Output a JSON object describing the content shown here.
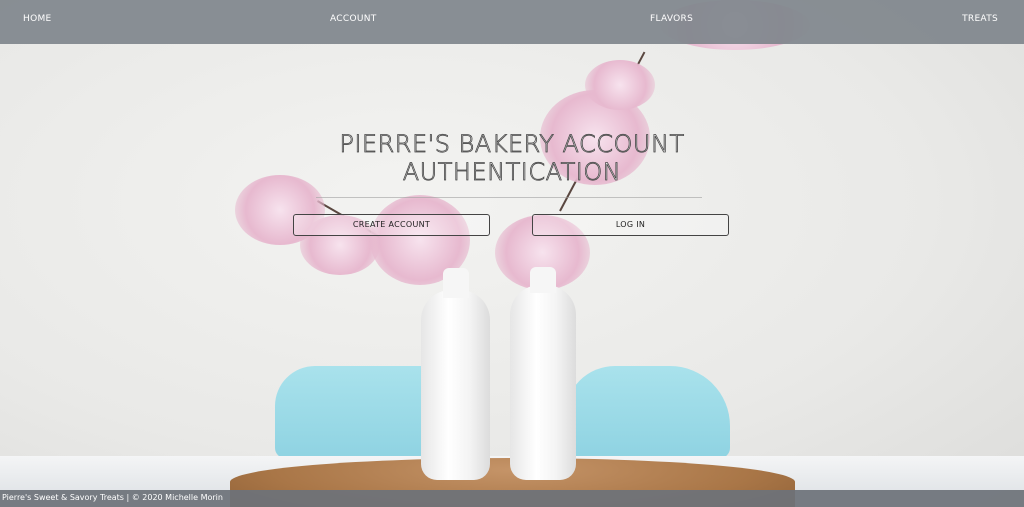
{
  "nav": {
    "home": "HOME",
    "account": "ACCOUNT",
    "flavors": "FLAVORS",
    "treats": "TREATS"
  },
  "hero": {
    "title_line1": "PIERRE'S BAKERY ACCOUNT",
    "title_line2": "AUTHENTICATION",
    "create_account_label": "CREATE ACCOUNT",
    "login_label": "LOG IN"
  },
  "footer": {
    "text": "Pierre's Sweet & Savory Treats | © 2020 Michelle Morin"
  },
  "colors": {
    "navbar": "#80868d",
    "footer": "#6c7279",
    "chair": "#a9e2ec",
    "blossom": "#e7b9cf"
  }
}
